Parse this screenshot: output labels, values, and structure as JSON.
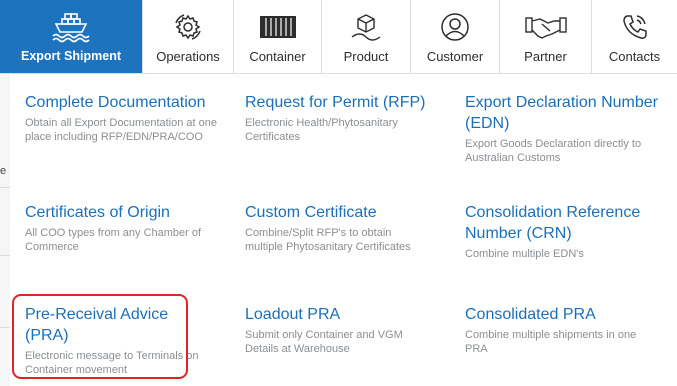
{
  "nav": {
    "tabs": [
      {
        "label": "Export Shipment",
        "icon": "ship-icon",
        "active": true
      },
      {
        "label": "Operations",
        "icon": "gear-icon",
        "active": false
      },
      {
        "label": "Container",
        "icon": "container-icon",
        "active": false
      },
      {
        "label": "Product",
        "icon": "box-icon",
        "active": false
      },
      {
        "label": "Customer",
        "icon": "user-icon",
        "active": false
      },
      {
        "label": "Partner",
        "icon": "handshake-icon",
        "active": false
      },
      {
        "label": "Contacts",
        "icon": "phone-icon",
        "active": false
      }
    ],
    "accent": "#1e73be"
  },
  "background": {
    "fragment_text": "e"
  },
  "menu": {
    "items": [
      {
        "title": "Complete Documentation",
        "desc": "Obtain all Export Documentation at one place including RFP/EDN/PRA/COO"
      },
      {
        "title": "Request for Permit (RFP)",
        "desc": "Electronic Health/Phytosanitary Certificates"
      },
      {
        "title": "Export Declaration Number (EDN)",
        "desc": "Export Goods Declaration directly to Australian Customs"
      },
      {
        "title": "Certificates of Origin",
        "desc": "All COO types from any Chamber of Commerce"
      },
      {
        "title": "Custom Certificate",
        "desc": "Combine/Split RFP's to obtain multiple Phytosanitary Certificates"
      },
      {
        "title": "Consolidation Reference Number (CRN)",
        "desc": "Combine multiple EDN's"
      },
      {
        "title": "Pre-Receival Advice (PRA)",
        "desc": "Electronic message to Terminals on Container movement"
      },
      {
        "title": "Loadout PRA",
        "desc": "Submit only Container and VGM Details at Warehouse"
      },
      {
        "title": "Consolidated PRA",
        "desc": "Combine multiple shipments in one PRA"
      }
    ],
    "title_color": "#1b6fb8",
    "desc_color": "#8a8f94",
    "highlight_color": "#e02424"
  }
}
